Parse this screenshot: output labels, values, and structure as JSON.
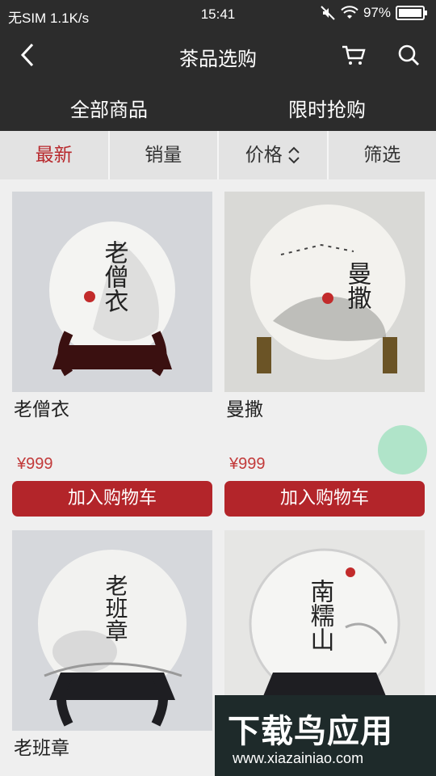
{
  "status_bar": {
    "carrier": "无SIM 1.1K/s",
    "time": "15:41",
    "battery": "97%"
  },
  "header": {
    "title": "茶品选购"
  },
  "tabs": [
    {
      "label": "全部商品"
    },
    {
      "label": "限时抢购"
    }
  ],
  "sort": [
    {
      "label": "最新",
      "active": true
    },
    {
      "label": "销量"
    },
    {
      "label": "价格"
    },
    {
      "label": "筛选"
    }
  ],
  "products": [
    {
      "name": "老僧衣",
      "cake_text": "老僧衣",
      "price": "¥999",
      "button": "加入购物车"
    },
    {
      "name": "曼撒",
      "cake_text": "曼撒",
      "price": "¥999",
      "button": "加入购物车"
    },
    {
      "name": "老班章",
      "cake_text": "老班章",
      "price": "",
      "button": ""
    },
    {
      "name": "",
      "cake_text": "南糯山",
      "price": "",
      "button": ""
    }
  ],
  "watermark": {
    "title": "下载鸟应用",
    "url": "www.xiazainiao.com"
  },
  "colors": {
    "bar": "#2c2c2c",
    "accent": "#b3252a",
    "active_sort": "#b8282c"
  }
}
